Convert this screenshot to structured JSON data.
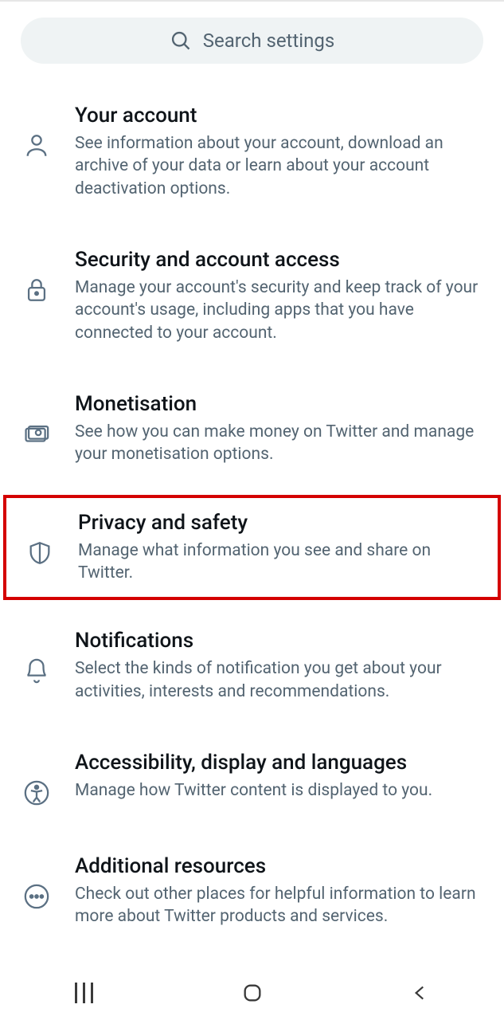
{
  "search": {
    "placeholder": "Search settings"
  },
  "settings": [
    {
      "icon": "person-icon",
      "title": "Your account",
      "desc": "See information about your account, download an archive of your data or learn about your account deactivation options.",
      "highlighted": false
    },
    {
      "icon": "lock-icon",
      "title": "Security and account access",
      "desc": "Manage your account's security and keep track of your account's usage, including apps that you have connected to your account.",
      "highlighted": false
    },
    {
      "icon": "money-icon",
      "title": "Monetisation",
      "desc": "See how you can make money on Twitter and manage your monetisation options.",
      "highlighted": false
    },
    {
      "icon": "shield-icon",
      "title": "Privacy and safety",
      "desc": "Manage what information you see and share on Twitter.",
      "highlighted": true
    },
    {
      "icon": "bell-icon",
      "title": "Notifications",
      "desc": "Select the kinds of notification you get about your activities, interests and recommendations.",
      "highlighted": false
    },
    {
      "icon": "accessibility-icon",
      "title": "Accessibility, display and languages",
      "desc": "Manage how Twitter content is displayed to you.",
      "highlighted": false
    },
    {
      "icon": "more-icon",
      "title": "Additional resources",
      "desc": "Check out other places for helpful information to learn more about Twitter products and services.",
      "highlighted": false
    }
  ]
}
